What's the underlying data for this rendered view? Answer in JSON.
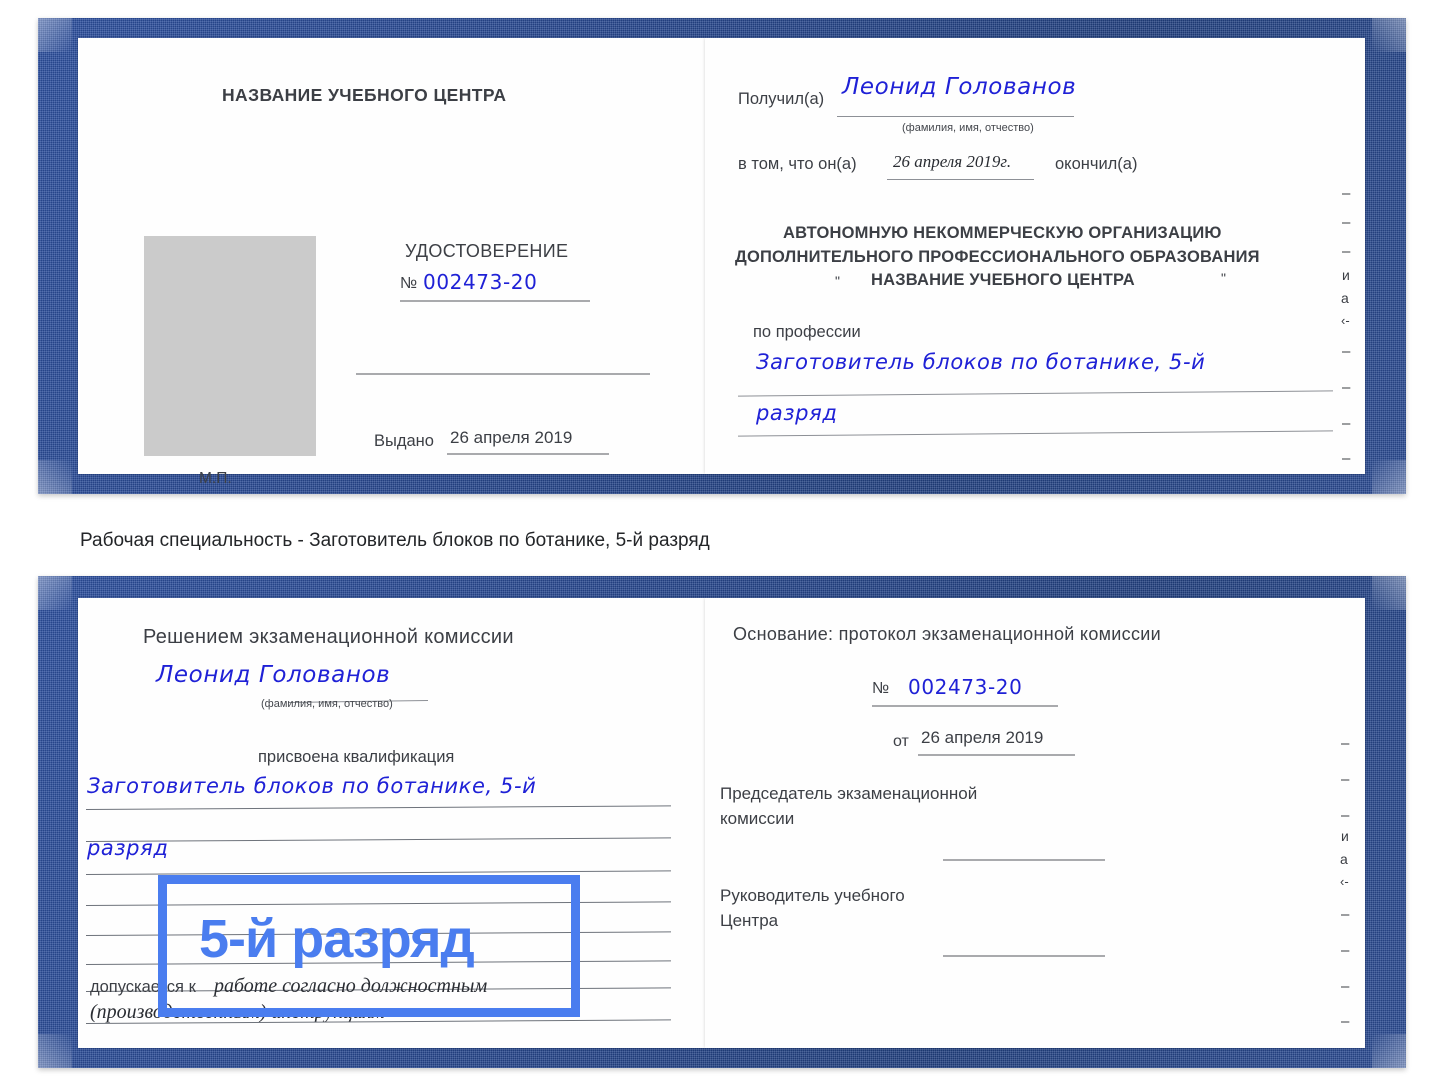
{
  "caption": {
    "text": "Рабочая специальность - Заготовитель блоков по ботанике, 5-й разряд"
  },
  "colors": {
    "binder_blue": "#27478f",
    "ink_blue": "#1f21d6",
    "highlight_blue": "#4a7def",
    "photo_gray": "#cbcbcb",
    "text_gray": "#3c3f45"
  },
  "annotation": {
    "label": "5-й разряд"
  },
  "certificate_top": {
    "left_page": {
      "header": "НАЗВАНИЕ УЧЕБНОГО ЦЕНТРА",
      "doc_type": "УДОСТОВЕРЕНИЕ",
      "number_prefix": "№",
      "number_value": "002473-20",
      "issued_label": "Выдано",
      "issued_value": "26 апреля 2019",
      "seal_label": "М.П."
    },
    "right_page": {
      "received_label": "Получил(а)",
      "received_value": "Леонид Голованов",
      "fio_hint": "(фамилия, имя, отчество)",
      "in_that_label": "в том, что он(а)",
      "in_that_value": "26 апреля 2019г.",
      "finished_label": "окончил(а)",
      "org_line1": "АВТОНОМНУЮ НЕКОММЕРЧЕСКУЮ ОРГАНИЗАЦИЮ",
      "org_line2": "ДОПОЛНИТЕЛЬНОГО ПРОФЕССИОНАЛЬНОГО ОБРАЗОВАНИЯ",
      "org_quote_open": "\"",
      "org_line3": "НАЗВАНИЕ УЧЕБНОГО ЦЕНТРА",
      "org_quote_close": "\"",
      "profession_label": "по профессии",
      "profession_line1": "Заготовитель блоков по ботанике, 5-й",
      "profession_line2": "разряд",
      "edge_marks": [
        "–",
        "–",
        "–",
        "–",
        "и",
        "а",
        "‹-",
        "–",
        "–",
        "–",
        "–"
      ]
    }
  },
  "certificate_bottom": {
    "left_page": {
      "decision_header": "Решением экзаменационной комиссии",
      "name_value": "Леонид Голованов",
      "fio_hint": "(фамилия, имя, отчество)",
      "qualification_label": "присвоена квалификация",
      "qualification_line1": "Заготовитель блоков по ботанике, 5-й",
      "qualification_line2": "разряд",
      "allowed_label": "допускается к",
      "allowed_value_line1": "работе согласно должностным",
      "allowed_value_line2": "(производственным) инструкциям"
    },
    "right_page": {
      "basis_label": "Основание: протокол экзаменационной комиссии",
      "number_prefix": "№",
      "number_value": "002473-20",
      "date_prefix": "от",
      "date_value": "26 апреля 2019",
      "chairman_line1": "Председатель экзаменационной",
      "chairman_line2": "комиссии",
      "head_line1": "Руководитель учебного",
      "head_line2": "Центра",
      "edge_marks": [
        "–",
        "–",
        "–",
        "и",
        "а",
        "‹-",
        "–",
        "–",
        "–",
        "–"
      ]
    }
  }
}
